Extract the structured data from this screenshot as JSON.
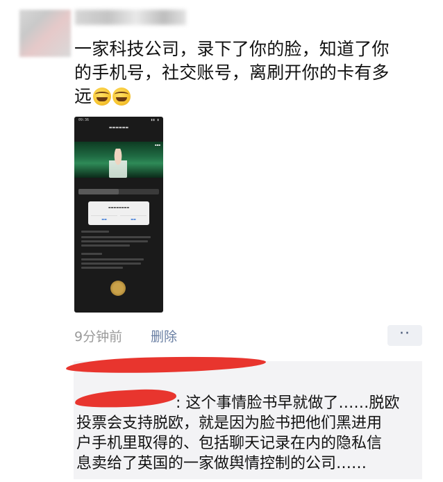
{
  "post": {
    "text_line1": "一家科技公司，录下了你的脸，知道了你",
    "text_line2": "的手机号，社交账号，离刷开你的卡有多",
    "text_line3": "远",
    "emoji_icons": [
      "laugh-cry-icon",
      "laugh-cry-icon"
    ]
  },
  "meta": {
    "time": "9分钟前",
    "delete_label": "删除",
    "more_label": "··"
  },
  "comment": {
    "line1": ": 这个事情脸书早就做了……脱欧",
    "line2": "投票会支持脱欧，就是因为脸书把他们黑进用",
    "line3": "户手机里取得的、包括聊天记录在内的隐私信",
    "line4": "息卖给了英国的一家做舆情控制的公司……"
  },
  "colors": {
    "redaction": "#e8352e",
    "link": "#6a7fa3",
    "comment_bg": "#f3f3f5"
  }
}
